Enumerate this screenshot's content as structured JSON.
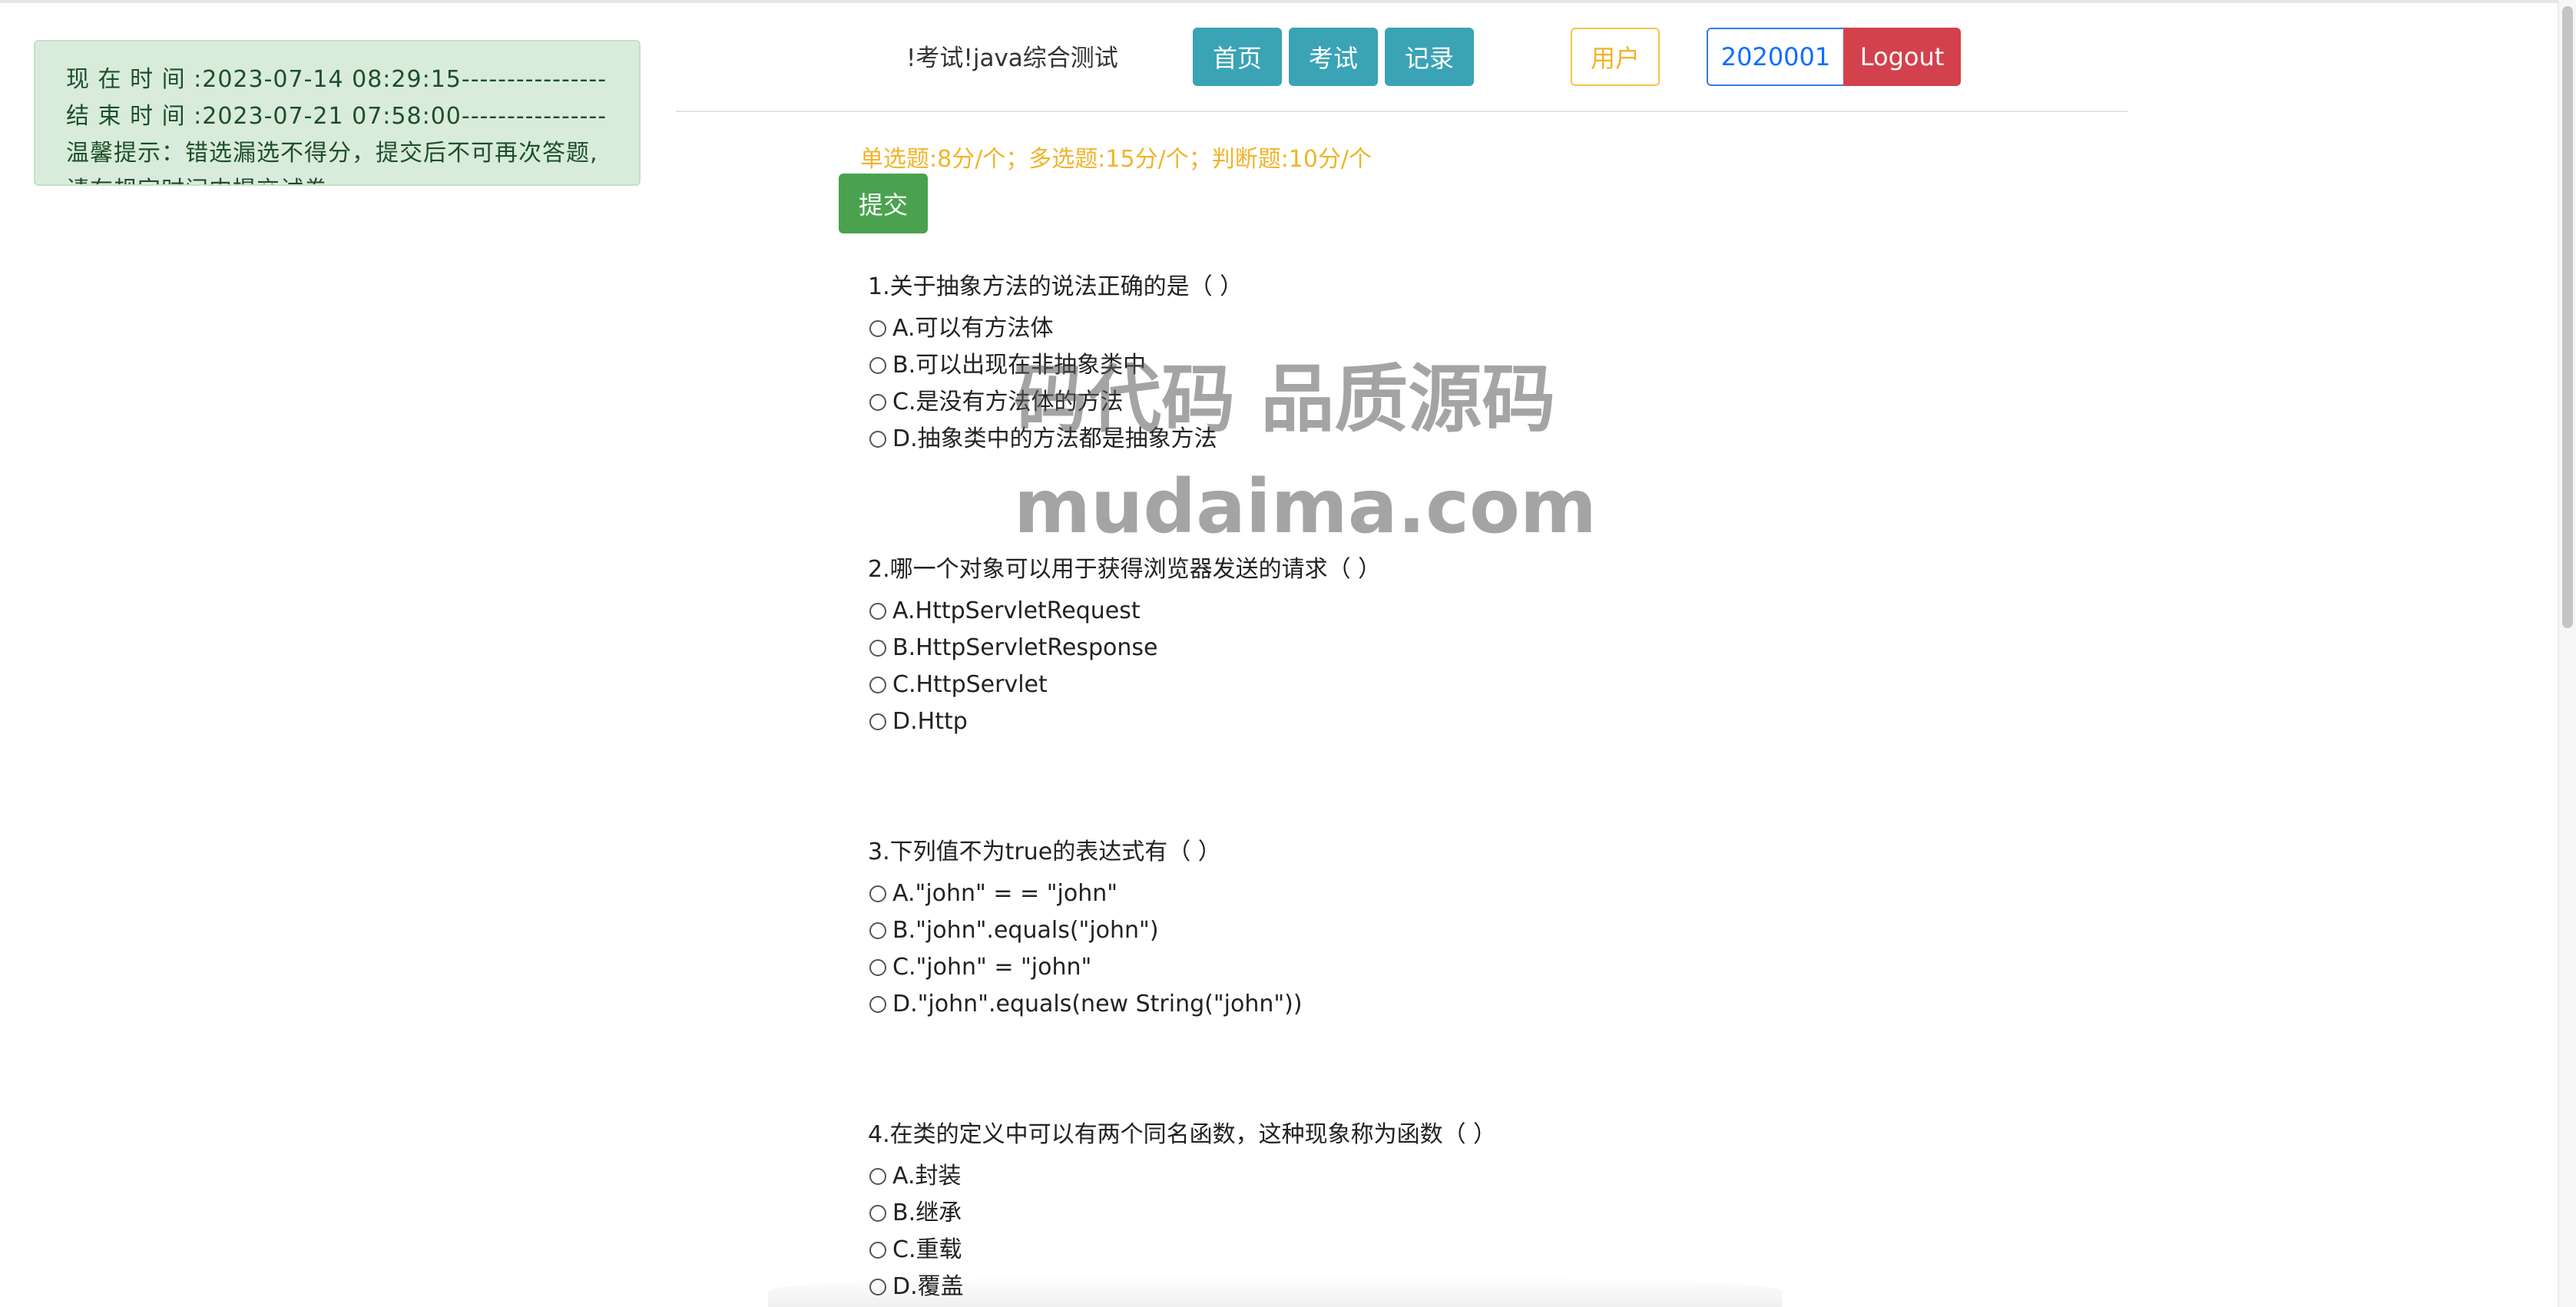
{
  "notice": {
    "text": "现 在 时 间 :2023-07-14 08:29:15----------------结 束 时 间 :2023-07-21 07:58:00----------------温馨提示：错选漏选不得分，提交后不可再次答题,请在规定时间内提交试卷."
  },
  "header": {
    "exam_title": "!考试!java综合测试",
    "nav": {
      "home": "首页",
      "exam": "考试",
      "records": "记录"
    },
    "user_label": "用户",
    "user_id": "2020001",
    "logout": "Logout"
  },
  "score_info": "单选题:8分/个；多选题:15分/个；判断题:10分/个",
  "submit_label": "提交",
  "questions": [
    {
      "title": "1.关于抽象方法的说法正确的是（ ）",
      "options": [
        "A.可以有方法体",
        "B.可以出现在非抽象类中",
        "C.是没有方法体的方法",
        "D.抽象类中的方法都是抽象方法"
      ]
    },
    {
      "title": "2.哪一个对象可以用于获得浏览器发送的请求（ ）",
      "options": [
        "A.HttpServletRequest",
        "B.HttpServletResponse",
        "C.HttpServlet",
        "D.Http"
      ]
    },
    {
      "title": "3.下列值不为true的表达式有（ ）",
      "options": [
        "A.\"john\" = = \"john\"",
        "B.\"john\".equals(\"john\")",
        "C.\"john\" = \"john\"",
        "D.\"john\".equals(new String(\"john\"))"
      ]
    },
    {
      "title": "4.在类的定义中可以有两个同名函数，这种现象称为函数（ ）",
      "options": [
        "A.封装",
        "B.继承",
        "C.重载",
        "D.覆盖"
      ]
    }
  ],
  "watermark": {
    "line1": "码代码 品质源码",
    "line2": "mudaima.com"
  },
  "colors": {
    "info": "#3aa3b6",
    "warning": "#f0b429",
    "primary": "#0d6efd",
    "danger": "#d3414c",
    "success": "#4aa24f",
    "notice_bg": "#d9ecdb"
  }
}
